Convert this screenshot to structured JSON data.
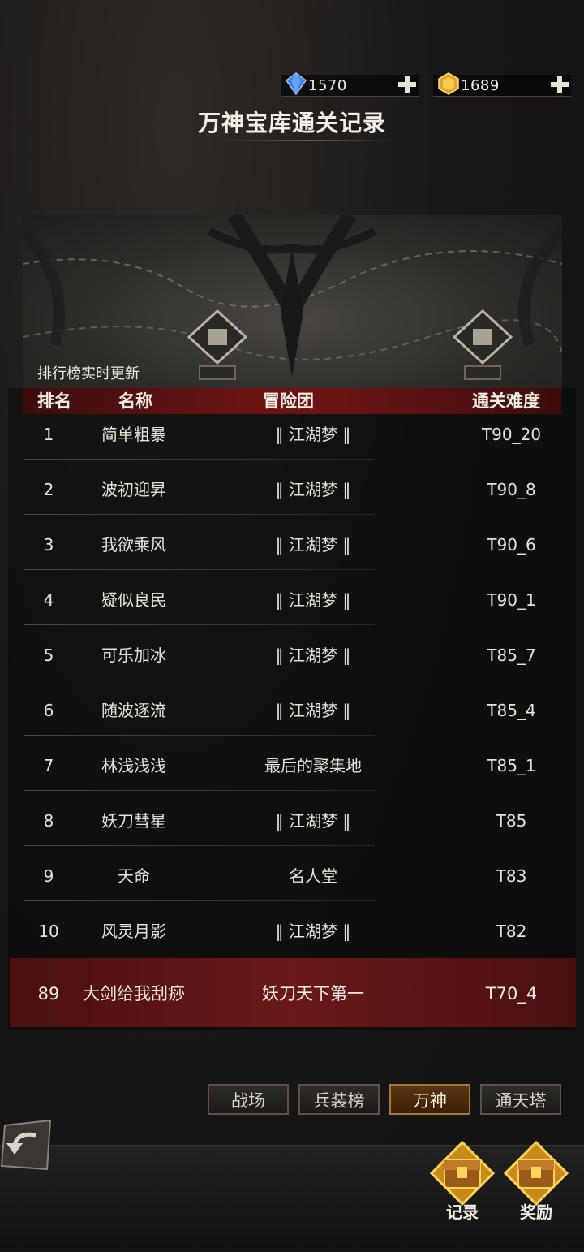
{
  "currencies": [
    {
      "icon": "blue-diamond-icon",
      "value": "1570"
    },
    {
      "icon": "gold-crystal-icon",
      "value": "1689"
    }
  ],
  "title": "万神宝库通关记录",
  "leaderboard": {
    "update_note": "排行榜实时更新",
    "headers": {
      "rank": "排名",
      "name": "名称",
      "guild": "冒险团",
      "level": "通关难度"
    },
    "rows": [
      {
        "rank": "1",
        "name": "简单粗暴",
        "guild": "‖ 江湖梦 ‖",
        "level": "T90_20"
      },
      {
        "rank": "2",
        "name": "波初迎昇",
        "guild": "‖ 江湖梦 ‖",
        "level": "T90_8"
      },
      {
        "rank": "3",
        "name": "我欲乘风",
        "guild": "‖ 江湖梦 ‖",
        "level": "T90_6"
      },
      {
        "rank": "4",
        "name": "疑似良民",
        "guild": "‖ 江湖梦 ‖",
        "level": "T90_1"
      },
      {
        "rank": "5",
        "name": "可乐加冰",
        "guild": "‖ 江湖梦 ‖",
        "level": "T85_7"
      },
      {
        "rank": "6",
        "name": "随波逐流",
        "guild": "‖ 江湖梦 ‖",
        "level": "T85_4"
      },
      {
        "rank": "7",
        "name": "林浅浅浅",
        "guild": "最后的聚集地",
        "level": "T85_1"
      },
      {
        "rank": "8",
        "name": "妖刀彗星",
        "guild": "‖ 江湖梦 ‖",
        "level": "T85"
      },
      {
        "rank": "9",
        "name": "天命",
        "guild": "名人堂",
        "level": "T83"
      },
      {
        "rank": "10",
        "name": "风灵月影",
        "guild": "‖ 江湖梦 ‖",
        "level": "T82"
      }
    ],
    "self": {
      "rank": "89",
      "name": "大剑给我刮痧",
      "guild": "妖刀天下第一",
      "level": "T70_4"
    }
  },
  "tabs": [
    {
      "label": "战场",
      "active": false
    },
    {
      "label": "兵装榜",
      "active": false
    },
    {
      "label": "万神",
      "active": true
    },
    {
      "label": "通天塔",
      "active": false
    }
  ],
  "bottom_buttons": {
    "record": "记录",
    "reward": "奖励"
  },
  "colors": {
    "header_red": "#6a1414",
    "self_row_red": "#6a1818",
    "active_tab": "#5a3512",
    "gold": "#e8a92a"
  }
}
